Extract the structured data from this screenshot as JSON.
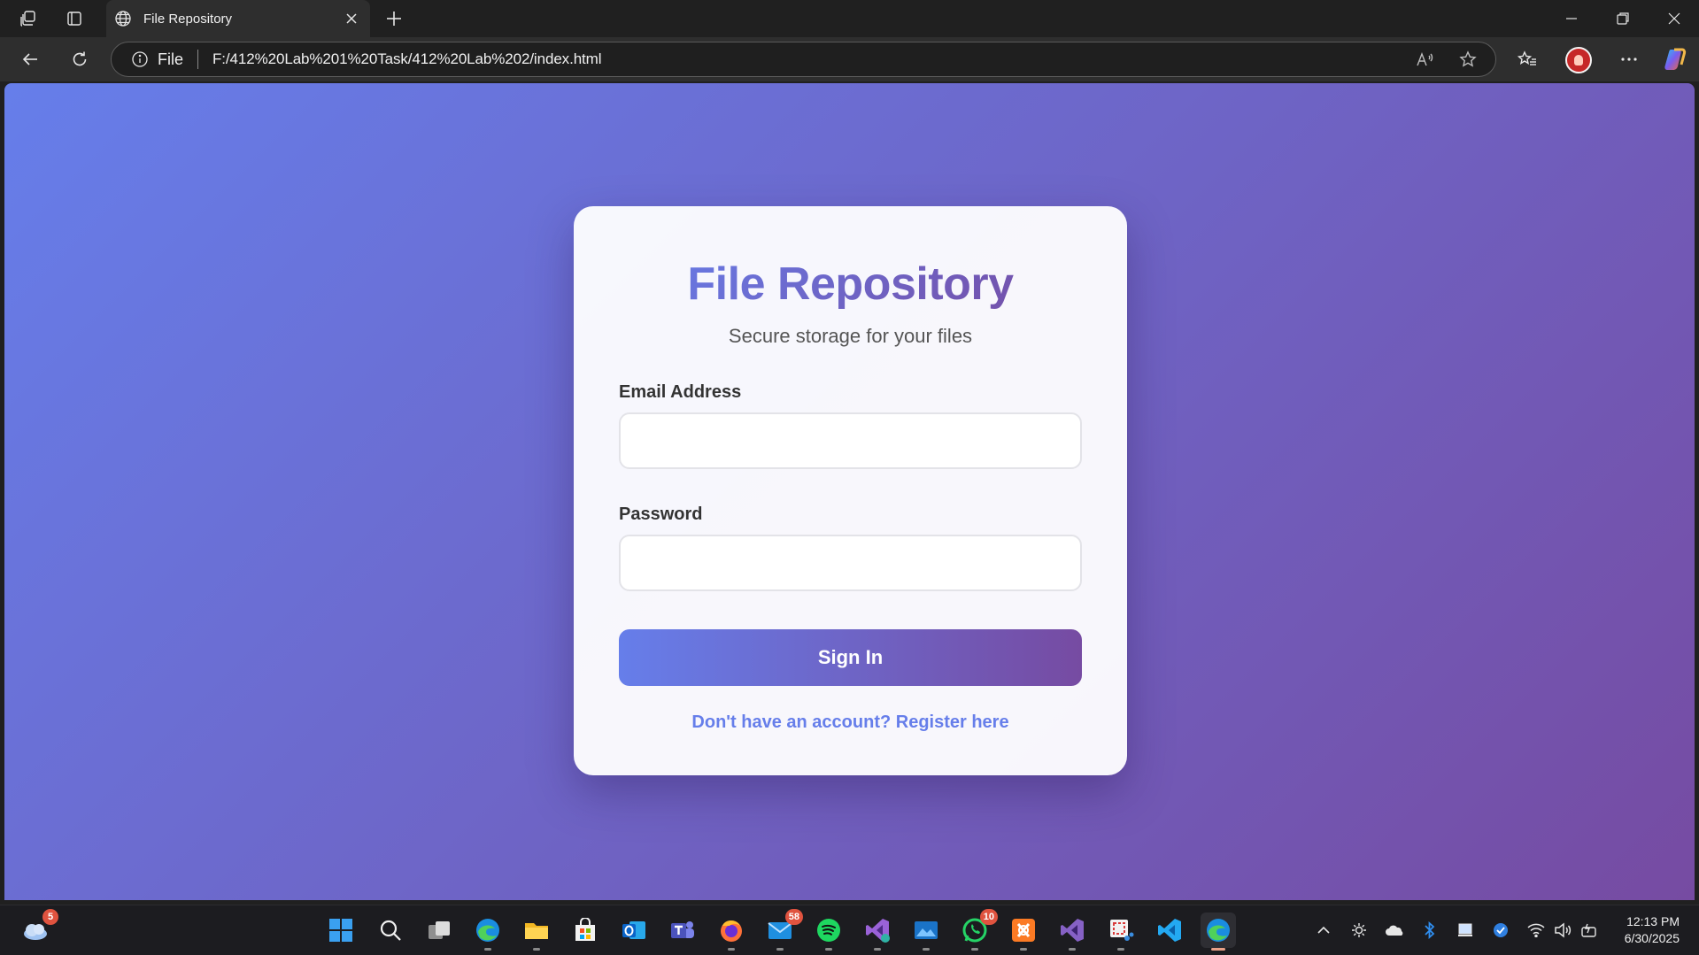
{
  "browser": {
    "tab_title": "File Repository",
    "scheme_label": "File",
    "url": "F:/412%20Lab%201%20Task/412%20Lab%202/index.html"
  },
  "page": {
    "title": "File Repository",
    "subtitle": "Secure storage for your files",
    "email_label": "Email Address",
    "email_value": "",
    "password_label": "Password",
    "password_value": "",
    "signin_label": "Sign In",
    "register_link": "Don't have an account? Register here",
    "colors": {
      "gradient_start": "#667eea",
      "gradient_end": "#764ba2"
    }
  },
  "taskbar": {
    "weather_badge": "5",
    "mail_badge": "58",
    "whatsapp_badge": "10",
    "apps": [
      "start-icon",
      "search-icon",
      "task-view-icon",
      "edge-icon",
      "file-explorer-icon",
      "store-icon",
      "outlook-icon",
      "teams-icon",
      "firefox-icon",
      "mail-icon",
      "spotify-icon",
      "visual-studio-icon",
      "photos-icon",
      "whatsapp-icon",
      "xampp-icon",
      "visual-studio-2-icon",
      "snipping-tool-icon",
      "vscode-icon",
      "edge-active-icon"
    ],
    "time": "12:13 PM",
    "date": "6/30/2025"
  }
}
